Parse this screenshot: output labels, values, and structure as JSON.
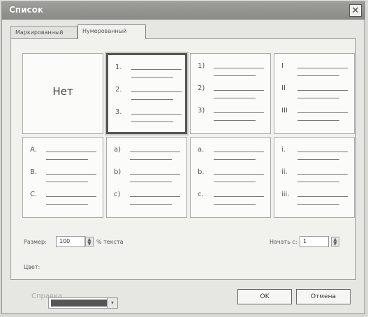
{
  "window": {
    "title": "Список"
  },
  "tabs": [
    {
      "label": "Маркированный",
      "active": false
    },
    {
      "label": "Нумерованный",
      "active": true
    }
  ],
  "styles": [
    {
      "id": "none",
      "name": "Нет",
      "markers": []
    },
    {
      "id": "arabic-dot",
      "name": "",
      "markers": [
        "1.",
        "2.",
        "3."
      ]
    },
    {
      "id": "arabic-paren",
      "name": "",
      "markers": [
        "1)",
        "2)",
        "3)"
      ]
    },
    {
      "id": "roman-upper",
      "name": "",
      "markers": [
        "I",
        "II",
        "III"
      ]
    },
    {
      "id": "alpha-upper",
      "name": "",
      "markers": [
        "A.",
        "B.",
        "C."
      ]
    },
    {
      "id": "alpha-paren",
      "name": "",
      "markers": [
        "a)",
        "b)",
        "c)"
      ]
    },
    {
      "id": "alpha-lower-dot",
      "name": "",
      "markers": [
        "a.",
        "b.",
        "c."
      ]
    },
    {
      "id": "roman-lower",
      "name": "",
      "markers": [
        "i.",
        "ii.",
        "iii."
      ]
    }
  ],
  "selected_style": "arabic-dot",
  "size": {
    "label": "Размер:",
    "value": "100",
    "suffix": "% текста"
  },
  "start": {
    "label": "Начать с:",
    "value": "1"
  },
  "color": {
    "label": "Цвет:",
    "swatch": "#555555"
  },
  "buttons": {
    "help": "Справка",
    "ok": "OK",
    "cancel": "Отмена"
  }
}
